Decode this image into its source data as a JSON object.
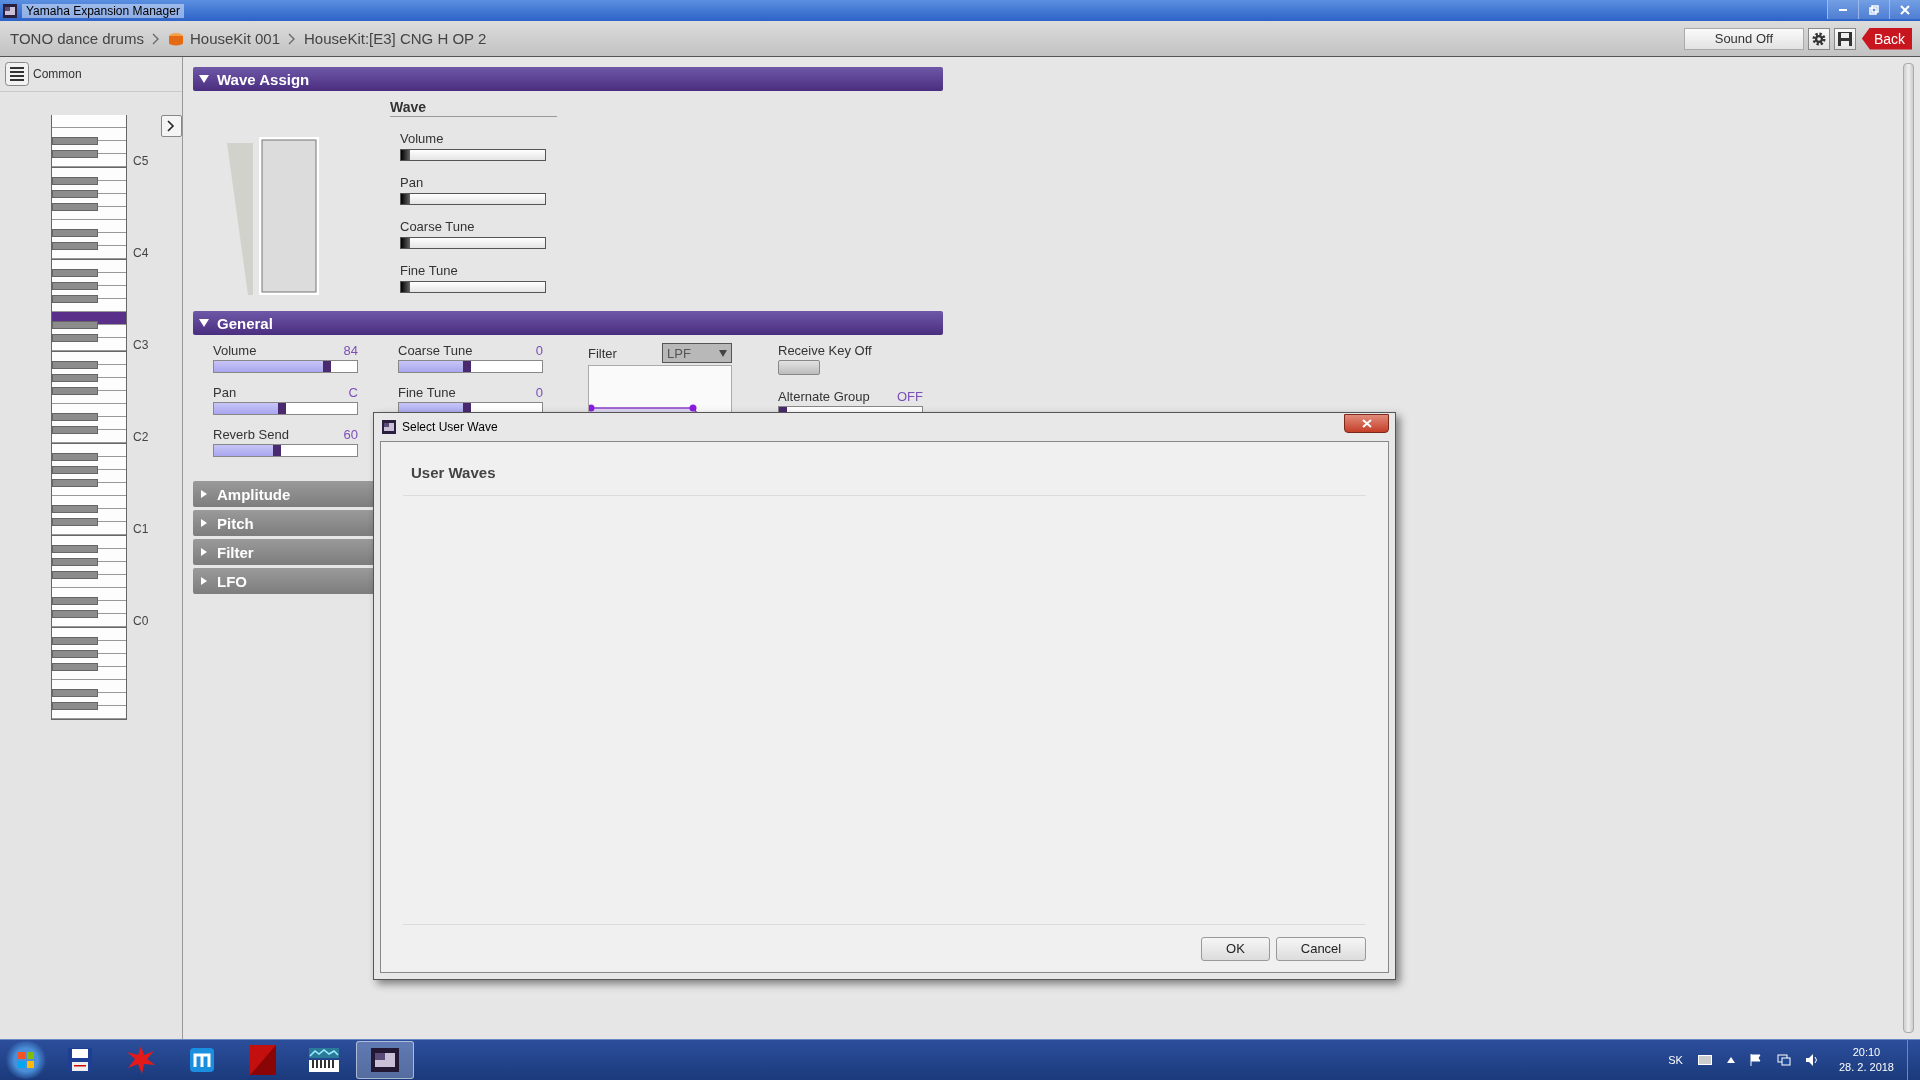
{
  "window": {
    "title": "Yamaha Expansion Manager"
  },
  "breadcrumb": [
    {
      "label": "TONO dance drums",
      "kind": "bank"
    },
    {
      "label": "HouseKit 001",
      "kind": "kit"
    },
    {
      "label": "HouseKit:[E3] CNG H OP 2",
      "kind": "key"
    }
  ],
  "toolbar": {
    "sound_button": "Sound Off",
    "back_button": "Back"
  },
  "sidebar": {
    "common_label": "Common",
    "octaves": [
      {
        "label": "C5",
        "selected": false
      },
      {
        "label": "C4",
        "selected": false
      },
      {
        "label": "C3",
        "selected": true
      },
      {
        "label": "C2",
        "selected": false
      },
      {
        "label": "C1",
        "selected": false
      },
      {
        "label": "C0",
        "selected": false
      }
    ]
  },
  "wave_assign": {
    "title": "Wave Assign",
    "expanded": true,
    "wave_label": "Wave",
    "params": [
      {
        "label": "Volume",
        "level": 0
      },
      {
        "label": "Pan",
        "level": 0
      },
      {
        "label": "Coarse Tune",
        "level": 0
      },
      {
        "label": "Fine Tune",
        "level": 0
      }
    ]
  },
  "general": {
    "title": "General",
    "expanded": true,
    "left_params": [
      {
        "label": "Volume",
        "value": "84",
        "level": 0.82
      },
      {
        "label": "Pan",
        "value": "C",
        "level": 0.5
      },
      {
        "label": "Reverb Send",
        "value": "60",
        "level": 0.47
      }
    ],
    "mid_params": [
      {
        "label": "Coarse Tune",
        "value": "0",
        "level": 0.5
      },
      {
        "label": "Fine Tune",
        "value": "0",
        "level": 0.5
      }
    ],
    "filter": {
      "label": "Filter",
      "type": "LPF"
    },
    "receive_key_off": {
      "label": "Receive Key Off",
      "on": false
    },
    "alternate_group": {
      "label": "Alternate Group",
      "value": "OFF",
      "level": 0
    }
  },
  "collapsed_sections": [
    {
      "title": "Amplitude",
      "expanded": false
    },
    {
      "title": "Pitch",
      "expanded": false
    },
    {
      "title": "Filter",
      "expanded": false
    },
    {
      "title": "LFO",
      "expanded": false
    }
  ],
  "dialog": {
    "title": "Select User Wave",
    "heading": "User Waves",
    "buttons": [
      "OK",
      "Cancel"
    ]
  },
  "taskbar": {
    "apps": [
      {
        "kind": "floppy",
        "selected": false
      },
      {
        "kind": "splat",
        "selected": false
      },
      {
        "kind": "browser",
        "selected": false
      },
      {
        "kind": "red",
        "selected": false
      },
      {
        "kind": "keyboard",
        "selected": false
      },
      {
        "kind": "window",
        "selected": true
      }
    ],
    "language": "SK",
    "time": "20:10",
    "date": "28. 2. 2018"
  }
}
